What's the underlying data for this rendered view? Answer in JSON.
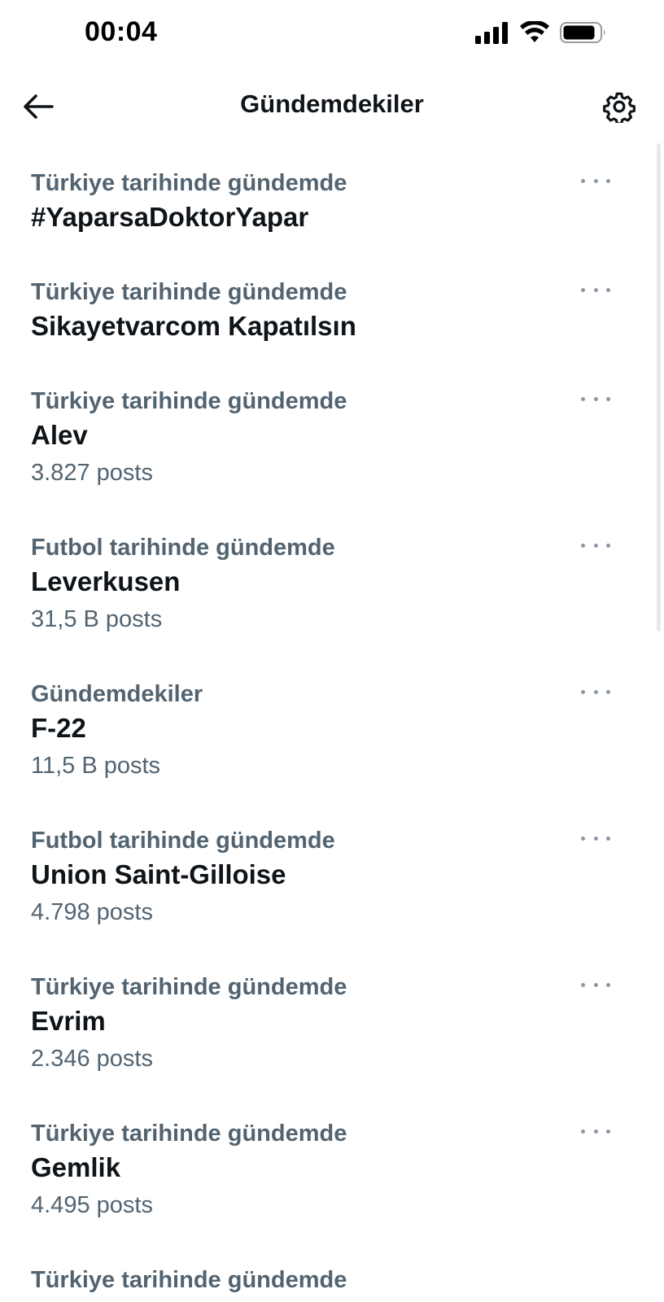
{
  "status_bar": {
    "time": "00:04",
    "icons": [
      "signal-icon",
      "wifi-icon",
      "battery-icon"
    ]
  },
  "header": {
    "back_icon": "arrow-left-icon",
    "title": "Gündemdekiler",
    "settings_icon": "gear-icon"
  },
  "trends": [
    {
      "context": "Türkiye tarihinde gündemde",
      "name": "#YaparsaDoktorYapar",
      "count": ""
    },
    {
      "context": "Türkiye tarihinde gündemde",
      "name": "Sikayetvarcom Kapatılsın",
      "count": ""
    },
    {
      "context": "Türkiye tarihinde gündemde",
      "name": "Alev",
      "count": "3.827 posts"
    },
    {
      "context": "Futbol tarihinde gündemde",
      "name": "Leverkusen",
      "count": "31,5 B posts"
    },
    {
      "context": "Gündemdekiler",
      "name": "F-22",
      "count": "11,5 B posts"
    },
    {
      "context": "Futbol tarihinde gündemde",
      "name": "Union Saint-Gilloise",
      "count": "4.798 posts"
    },
    {
      "context": "Türkiye tarihinde gündemde",
      "name": "Evrim",
      "count": "2.346 posts"
    },
    {
      "context": "Türkiye tarihinde gündemde",
      "name": "Gemlik",
      "count": "4.495 posts"
    },
    {
      "context": "Türkiye tarihinde gündemde",
      "name": "",
      "count": ""
    }
  ],
  "colors": {
    "primary_text": "#0f1419",
    "secondary_text": "#536471",
    "more_dots": "#8b98a5"
  }
}
